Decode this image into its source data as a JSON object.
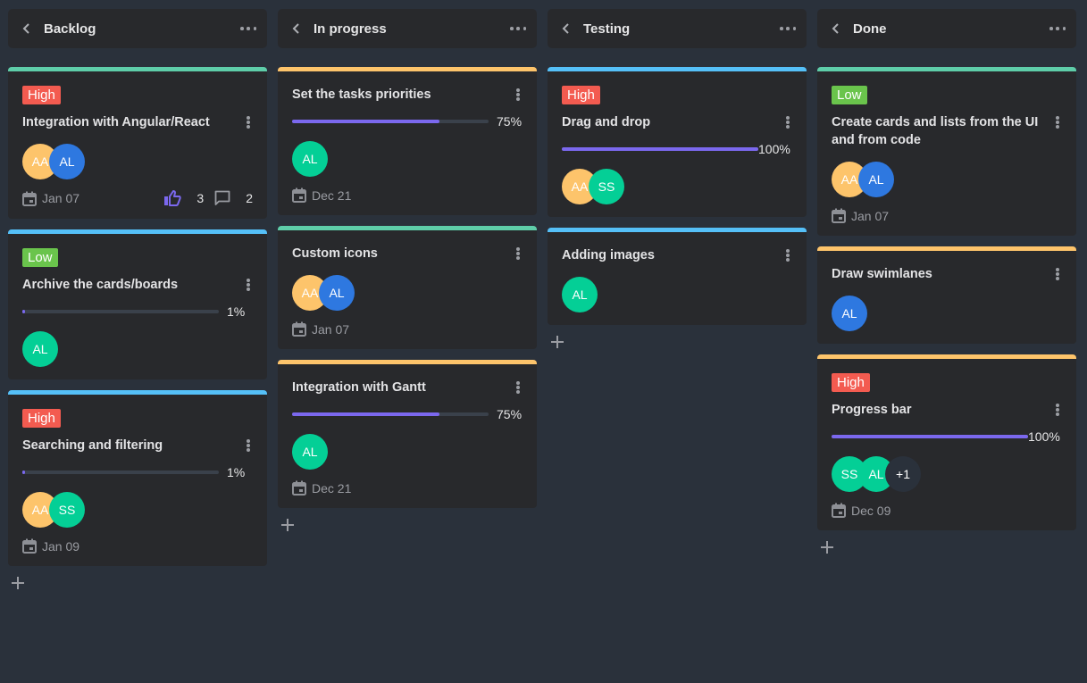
{
  "colors": {
    "background": "#2a313b",
    "panel": "#28292c",
    "high": "#f35b50",
    "low": "#6ac44c",
    "progress": "#7b68ee",
    "stripe_green": "#5ecda9",
    "stripe_blue": "#55c0f8",
    "stripe_orange": "#fdc46b",
    "avatar_aa": "#fdc46b",
    "avatar_al_blue": "#2e78e0",
    "avatar_green": "#04cf96",
    "avatar_more": "#2a313b"
  },
  "columns": [
    {
      "title": "Backlog",
      "add_label": "+",
      "cards": [
        {
          "stripe": "#5ecda9",
          "badge": "High",
          "badge_color": "#f35b50",
          "title": "Integration with Angular/React",
          "progress": null,
          "avatars": [
            {
              "initials": "AA",
              "color": "#fdc46b"
            },
            {
              "initials": "AL",
              "color": "#2e78e0"
            }
          ],
          "date": "Jan 07",
          "likes": "3",
          "comments": "2"
        },
        {
          "stripe": "#55c0f8",
          "badge": "Low",
          "badge_color": "#6ac44c",
          "title": "Archive the cards/boards",
          "progress": 1,
          "progress_label": "1%",
          "avatars": [
            {
              "initials": "AL",
              "color": "#04cf96"
            }
          ],
          "date": null
        },
        {
          "stripe": "#55c0f8",
          "badge": "High",
          "badge_color": "#f35b50",
          "title": "Searching and filtering",
          "progress": 1,
          "progress_label": "1%",
          "avatars": [
            {
              "initials": "AA",
              "color": "#fdc46b"
            },
            {
              "initials": "SS",
              "color": "#04cf96"
            }
          ],
          "date": "Jan 09"
        }
      ]
    },
    {
      "title": "In progress",
      "add_label": "+",
      "cards": [
        {
          "stripe": "#fdc46b",
          "badge": null,
          "title": "Set the tasks priorities",
          "progress": 75,
          "progress_label": "75%",
          "avatars": [
            {
              "initials": "AL",
              "color": "#04cf96"
            }
          ],
          "date": "Dec 21"
        },
        {
          "stripe": "#5ecda9",
          "badge": null,
          "title": "Custom icons",
          "progress": null,
          "avatars": [
            {
              "initials": "AA",
              "color": "#fdc46b"
            },
            {
              "initials": "AL",
              "color": "#2e78e0"
            }
          ],
          "date": "Jan 07"
        },
        {
          "stripe": "#fdc46b",
          "badge": null,
          "title": "Integration with Gantt",
          "progress": 75,
          "progress_label": "75%",
          "avatars": [
            {
              "initials": "AL",
              "color": "#04cf96"
            }
          ],
          "date": "Dec 21"
        }
      ]
    },
    {
      "title": "Testing",
      "add_label": "+",
      "cards": [
        {
          "stripe": "#55c0f8",
          "badge": "High",
          "badge_color": "#f35b50",
          "title": "Drag and drop",
          "progress": 100,
          "progress_label": "100%",
          "avatars": [
            {
              "initials": "AA",
              "color": "#fdc46b"
            },
            {
              "initials": "SS",
              "color": "#04cf96"
            }
          ],
          "date": null
        },
        {
          "stripe": "#55c0f8",
          "badge": null,
          "title": "Adding images",
          "progress": null,
          "avatars": [
            {
              "initials": "AL",
              "color": "#04cf96"
            }
          ],
          "date": null
        }
      ]
    },
    {
      "title": "Done",
      "add_label": "+",
      "cards": [
        {
          "stripe": "#5ecda9",
          "badge": "Low",
          "badge_color": "#6ac44c",
          "title": "Create cards and lists from the UI and from code",
          "progress": null,
          "avatars": [
            {
              "initials": "AA",
              "color": "#fdc46b"
            },
            {
              "initials": "AL",
              "color": "#2e78e0"
            }
          ],
          "date": "Jan 07"
        },
        {
          "stripe": "#fdc46b",
          "badge": null,
          "title": "Draw swimlanes",
          "progress": null,
          "avatars": [
            {
              "initials": "AL",
              "color": "#2e78e0"
            }
          ],
          "date": null
        },
        {
          "stripe": "#fdc46b",
          "badge": "High",
          "badge_color": "#f35b50",
          "title": "Progress bar",
          "progress": 100,
          "progress_label": "100%",
          "avatars": [
            {
              "initials": "SS",
              "color": "#04cf96"
            },
            {
              "initials": "AL",
              "color": "#04cf96"
            },
            {
              "initials": "+1",
              "color": "#2a313b"
            }
          ],
          "date": "Dec 09"
        }
      ]
    }
  ]
}
